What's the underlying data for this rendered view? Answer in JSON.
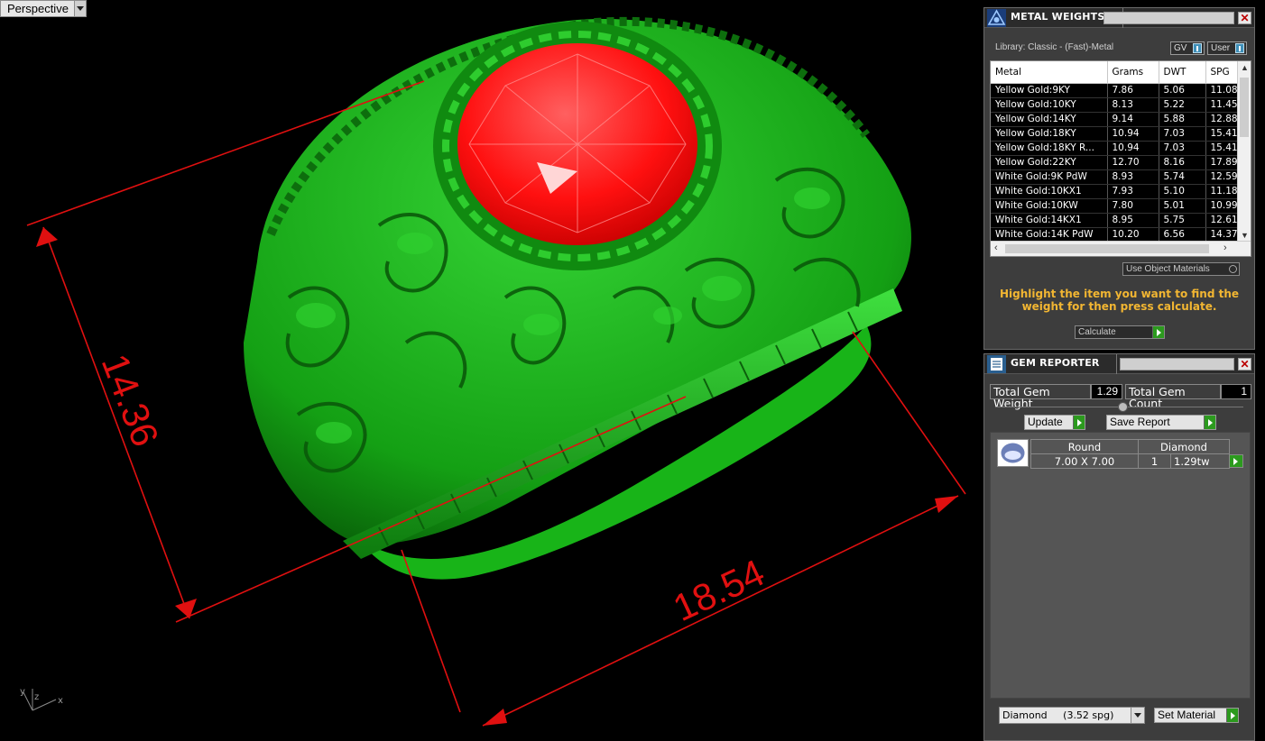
{
  "viewport": {
    "label": "Perspective",
    "dim_height": "14.36",
    "dim_width": "18.54",
    "axis_x": "x",
    "axis_y": "y",
    "axis_z": "z",
    "colors": {
      "ring": "#1fb51f",
      "gem": "#ff1a1a",
      "dimension": "#e01010"
    }
  },
  "metal_weights": {
    "title": "METAL WEIGHTS",
    "library": "Library: Classic - (Fast)-Metal",
    "toggle_gv": "GV",
    "toggle_user": "User",
    "columns": [
      "Metal",
      "Grams",
      "DWT",
      "SPG"
    ],
    "rows": [
      [
        "Yellow Gold:9KY",
        "7.86",
        "5.06",
        "11.08"
      ],
      [
        "Yellow Gold:10KY",
        "8.13",
        "5.22",
        "11.45"
      ],
      [
        "Yellow Gold:14KY",
        "9.14",
        "5.88",
        "12.88"
      ],
      [
        "Yellow Gold:18KY",
        "10.94",
        "7.03",
        "15.41"
      ],
      [
        "Yellow Gold:18KY R...",
        "10.94",
        "7.03",
        "15.41"
      ],
      [
        "Yellow Gold:22KY",
        "12.70",
        "8.16",
        "17.89"
      ],
      [
        "White Gold:9K PdW",
        "8.93",
        "5.74",
        "12.59"
      ],
      [
        "White Gold:10KX1",
        "7.93",
        "5.10",
        "11.18"
      ],
      [
        "White Gold:10KW",
        "7.80",
        "5.01",
        "10.99"
      ],
      [
        "White Gold:14KX1",
        "8.95",
        "5.75",
        "12.61"
      ],
      [
        "White Gold:14K PdW",
        "10.20",
        "6.56",
        "14.37"
      ]
    ],
    "use_object_materials": "Use Object Materials",
    "notice": "Highlight the item you want to find the weight for then press calculate.",
    "calculate": "Calculate"
  },
  "gem_reporter": {
    "title": "GEM REPORTER",
    "total_weight_label": "Total Gem Weight",
    "total_weight_value": "1.29",
    "total_count_label": "Total Gem Count",
    "total_count_value": "1",
    "update": "Update",
    "save_report": "Save Report",
    "gem": {
      "shape": "Round",
      "type": "Diamond",
      "size": "7.00 X 7.00",
      "count": "1",
      "weight": "1.29tw"
    },
    "material_select": "Diamond     (3.52 spg)",
    "set_material": "Set Material"
  }
}
